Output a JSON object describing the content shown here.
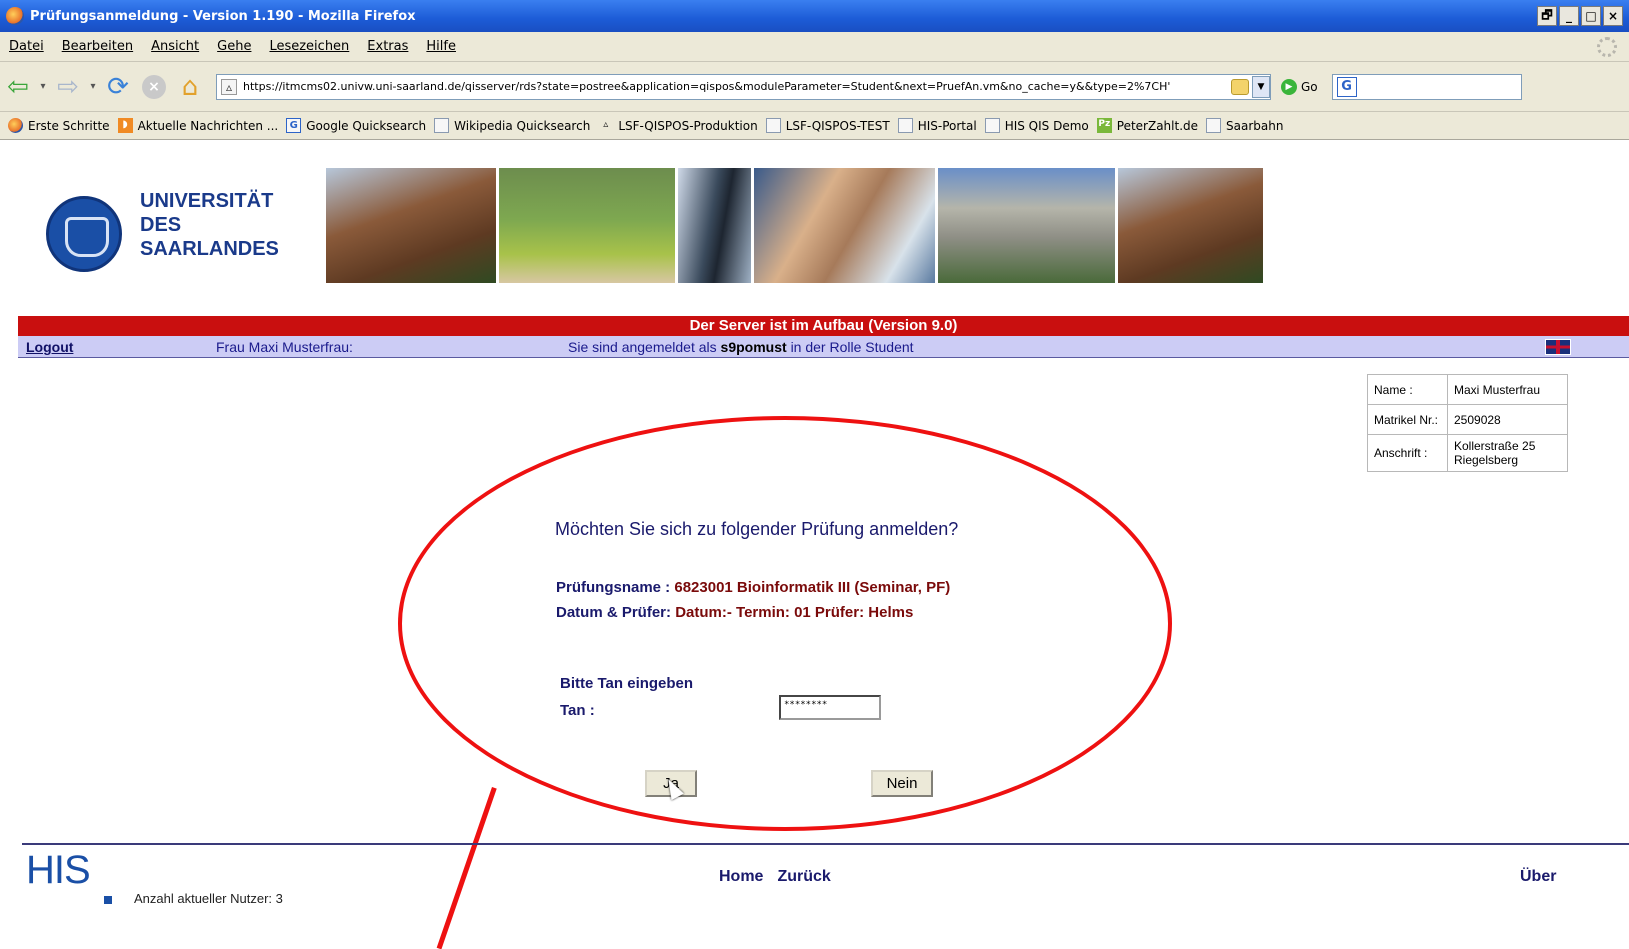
{
  "window": {
    "title": "Prüfungsanmeldung - Version 1.190 - Mozilla Firefox",
    "buttons": [
      "🗗",
      "_",
      "□",
      "×"
    ]
  },
  "menu": [
    "Datei",
    "Bearbeiten",
    "Ansicht",
    "Gehe",
    "Lesezeichen",
    "Extras",
    "Hilfe"
  ],
  "nav": {
    "url": "https://itmcms02.univw.uni-saarland.de/qisserver/rds?state=postree&application=qispos&moduleParameter=Student&next=PruefAn.vm&no_cache=y&&type=2%7CH'",
    "go_label": "Go"
  },
  "bookmarks": [
    "Erste Schritte",
    "Aktuelle Nachrichten ...",
    "Google Quicksearch",
    "Wikipedia Quicksearch",
    "LSF-QISPOS-Produktion",
    "LSF-QISPOS-TEST",
    "HIS-Portal",
    "HIS QIS Demo",
    "PeterZahlt.de",
    "Saarbahn"
  ],
  "header": {
    "uni_line1": "UNIVERSITÄT",
    "uni_line2": "DES",
    "uni_line3": "SAARLANDES"
  },
  "server_status": "Der Server ist im Aufbau (Version 9.0)",
  "login": {
    "logout": "Logout",
    "user": "Frau Maxi Musterfrau:",
    "info_prefix": "Sie sind angemeldet als",
    "account": "s9pomust",
    "info_suffix": "in der Rolle Student"
  },
  "student": {
    "name_label": "Name :",
    "name": "Maxi Musterfrau",
    "matrikel_label": "Matrikel Nr.:",
    "matrikel": "2509028",
    "address_label": "Anschrift :",
    "address_line1": "Kollerstraße 25",
    "address_line2": "Riegelsberg"
  },
  "form": {
    "question": "Möchten Sie sich zu folgender Prüfung anmelden?",
    "exam_label": "Prüfungsname :",
    "exam_value": "6823001 Bioinformatik III (Seminar, PF)",
    "date_label": "Datum  & Prüfer:",
    "date_value": "Datum:- Termin: 01 Prüfer: Helms",
    "tan_title": "Bitte Tan eingeben",
    "tan_label": "Tan :",
    "tan_value": "********",
    "yes": "Ja",
    "no": "Nein"
  },
  "footer": {
    "logo": "HIS",
    "user_count": "Anzahl aktueller Nutzer: 3",
    "home": "Home",
    "back": "Zurück",
    "about": "Über"
  },
  "colors": {
    "accent_red": "#c90f0f",
    "nav_bar": "#ccccf5",
    "text_blue": "#1a1a6c",
    "value_red": "#7a0a0a",
    "annotation": "#ee1111"
  }
}
